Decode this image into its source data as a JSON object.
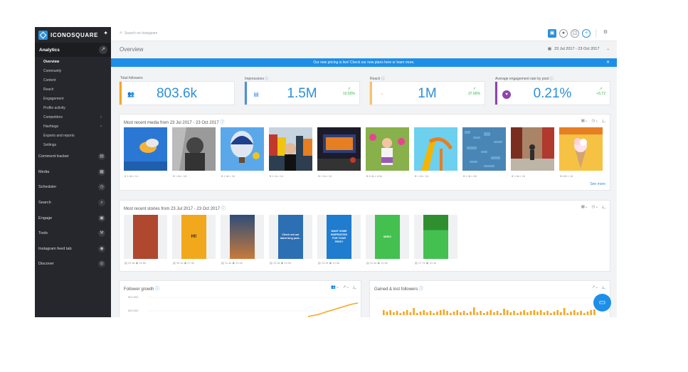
{
  "brand": {
    "name": "ICONOSQUARE"
  },
  "sidebar": {
    "analytics_label": "Analytics",
    "sub_items": [
      {
        "label": "Overview",
        "active": true
      },
      {
        "label": "Community"
      },
      {
        "label": "Content"
      },
      {
        "label": "Reach"
      },
      {
        "label": "Engagement"
      },
      {
        "label": "Profile activity"
      },
      {
        "label": "Competitors"
      },
      {
        "label": "Hashtags"
      },
      {
        "label": "Exports and reports"
      },
      {
        "label": "Settings"
      }
    ],
    "main_items": [
      {
        "label": "Comment tracker",
        "icon": "comment-icon"
      },
      {
        "label": "Media",
        "icon": "media-icon"
      },
      {
        "label": "Scheduler",
        "icon": "clock-icon"
      },
      {
        "label": "Search",
        "icon": "search-icon"
      },
      {
        "label": "Engage",
        "icon": "engage-icon"
      },
      {
        "label": "Tools",
        "icon": "wrench-icon"
      },
      {
        "label": "Instagram feed tab",
        "icon": "feed-icon"
      },
      {
        "label": "Discover",
        "icon": "compass-icon"
      }
    ]
  },
  "topbar": {
    "search_placeholder": "Search on Instagram"
  },
  "page": {
    "title": "Overview",
    "date_range": "23 Jul 2017 - 23 Oct 2017"
  },
  "banner": {
    "text": "Our new pricing is live! Check our new plans here or learn more."
  },
  "kpis": [
    {
      "label": "Total followers",
      "value": "803.6k",
      "color": "#f5a623",
      "icon": "followers-icon"
    },
    {
      "label": "Impressions",
      "value": "1.5M",
      "trend": "10.50%",
      "color": "#4a90e2",
      "icon": "document-icon"
    },
    {
      "label": "Reach",
      "value": "1M",
      "trend": "37.66%",
      "color": "#f7c36b",
      "icon": "reach-icon"
    },
    {
      "label": "Average engagement rate by post",
      "value": "0.21%",
      "trend": "+5.72",
      "color": "#8e44ad",
      "icon": "heart-icon"
    }
  ],
  "recent_media": {
    "title": "Most recent media from 23 Jul 2017 - 23 Oct 2017",
    "see_more": "See more",
    "items": [
      {
        "likes": "1.5k",
        "comments": "14"
      },
      {
        "likes": "1.6k",
        "comments": "18"
      },
      {
        "likes": "1.6k",
        "comments": "34"
      },
      {
        "likes": "1.1k",
        "comments": "14"
      },
      {
        "likes": "1.2k",
        "comments": "15"
      },
      {
        "likes": "8.3k",
        "comments": "6.0k"
      },
      {
        "likes": "1.2k",
        "comments": "16"
      },
      {
        "likes": "1.3k",
        "comments": "60"
      },
      {
        "likes": "1.6k",
        "comments": "18"
      },
      {
        "likes": "800",
        "comments": "16"
      }
    ]
  },
  "recent_stories": {
    "title": "Most recent stories from 23 Jul 2017 - 23 Oct 2017",
    "items": [
      {
        "views": "22.6k",
        "reach": "20.8k",
        "text": ""
      },
      {
        "views": "30.1k",
        "reach": "27.5k",
        "text": "HI!"
      },
      {
        "views": "11.4k",
        "reach": "10.4k",
        "text": ""
      },
      {
        "views": "12.5k",
        "reach": "10.9k",
        "text": "Check out our latest blog post..."
      },
      {
        "views": "13.2k",
        "reach": "12.5k",
        "text": "WANT SOME INSPIRATION FOR YOUR FEED?"
      },
      {
        "views": "11.4k",
        "reach": "10.5k",
        "text": "NEED!"
      },
      {
        "views": "17.7k",
        "reach": "10.1k",
        "text": ""
      }
    ]
  },
  "follower_growth": {
    "title": "Follower growth",
    "y_labels": [
      "800,000",
      "802,500"
    ]
  },
  "gained_lost": {
    "title": "Gained & lost followers"
  }
}
